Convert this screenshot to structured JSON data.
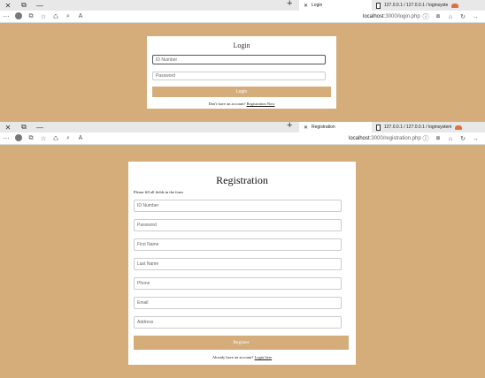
{
  "window1": {
    "tab_title": "Login",
    "address_host": "localhost",
    "address_path": ":3000/login.php",
    "login": {
      "title": "Login",
      "id_placeholder": "ID Number",
      "password_placeholder": "Password",
      "button": "Login",
      "footer_text": "Don't have an account?",
      "footer_link": "Registration Now"
    }
  },
  "window2": {
    "tab_title": "Registration",
    "tab2_title": "127.0.0.1 / 127.0.0.1 / loginsystem",
    "address_host": "localhost",
    "address_path": ":3000/registration.php",
    "registration": {
      "title": "Registration",
      "hint": "Please fill all fields in the form",
      "fields": [
        "ID Number",
        "Password",
        "First Name",
        "Last Name",
        "Phone",
        "Email",
        "Address"
      ],
      "button": "Register",
      "footer_text": "Already have an account?",
      "footer_link": "Login here"
    }
  },
  "window1_extra": {
    "tab2_title": "127.0.0.1 / 127.0.0.1 / loginsyste"
  },
  "colors": {
    "background": "#d4ad7b",
    "button": "#d4ad7b"
  }
}
